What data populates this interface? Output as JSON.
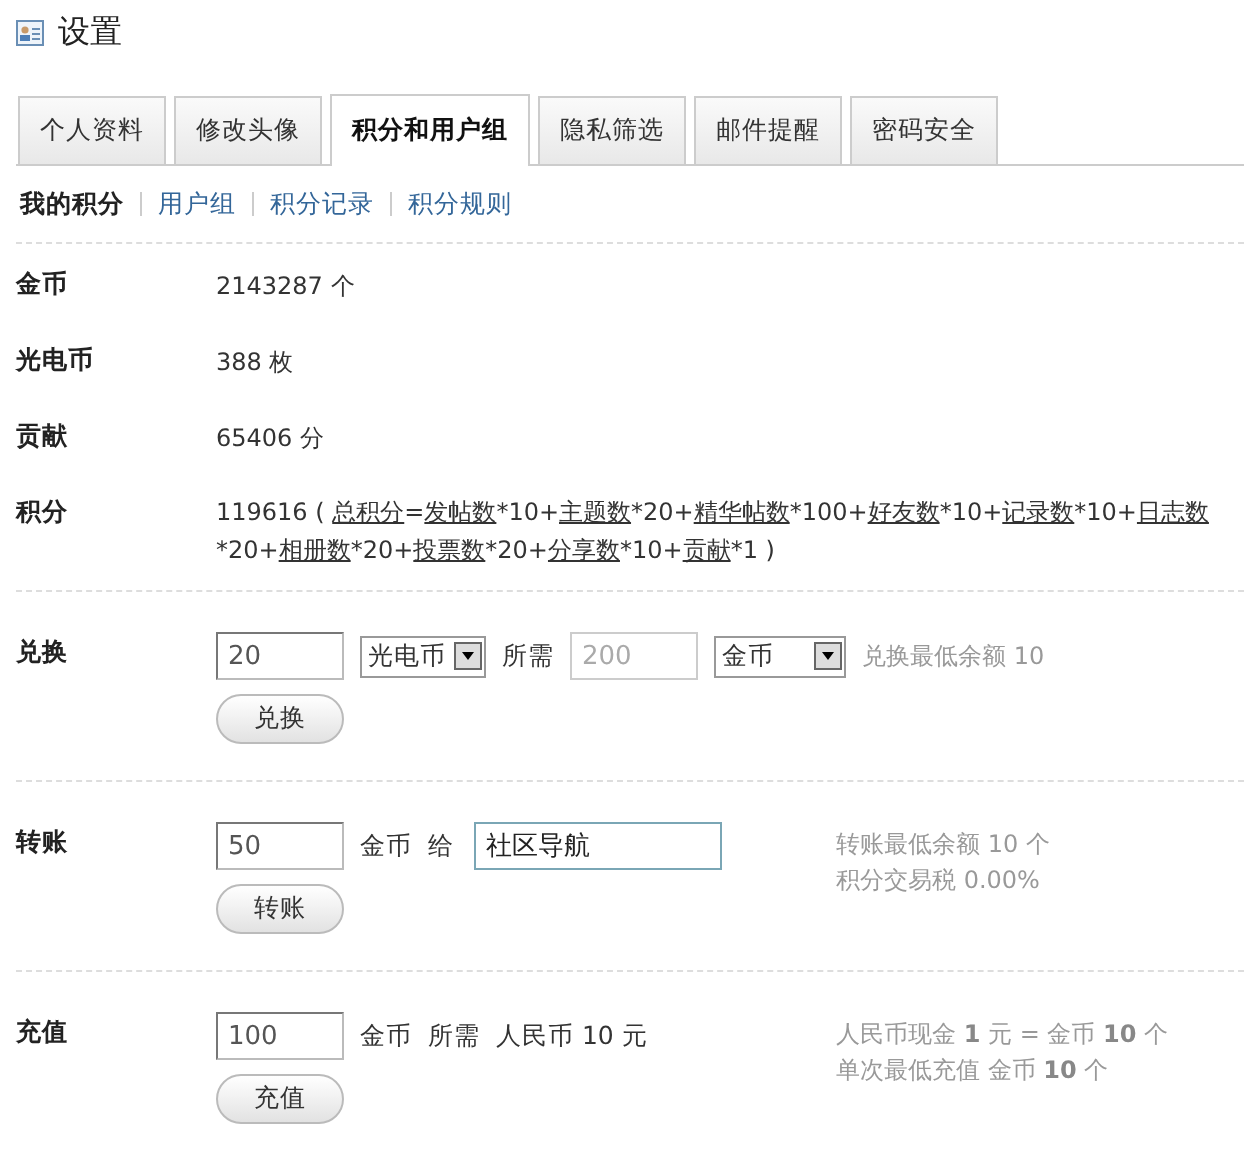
{
  "header": {
    "title": "设置"
  },
  "tabs": [
    {
      "label": "个人资料",
      "selected": false
    },
    {
      "label": "修改头像",
      "selected": false
    },
    {
      "label": "积分和用户组",
      "selected": true
    },
    {
      "label": "隐私筛选",
      "selected": false
    },
    {
      "label": "邮件提醒",
      "selected": false
    },
    {
      "label": "密码安全",
      "selected": false
    }
  ],
  "subnav": [
    {
      "label": "我的积分",
      "selected": true
    },
    {
      "label": "用户组",
      "selected": false
    },
    {
      "label": "积分记录",
      "selected": false
    },
    {
      "label": "积分规则",
      "selected": false
    }
  ],
  "stats": [
    {
      "label": "金币",
      "value": "2143287 个"
    },
    {
      "label": "光电币",
      "value": "388 枚"
    },
    {
      "label": "贡献",
      "value": "65406 分"
    }
  ],
  "credits": {
    "label": "积分",
    "value": "119616 (",
    "end": ")",
    "parts": [
      {
        "kind": "link",
        "text": "总积分"
      },
      {
        "kind": "text",
        "text": "="
      },
      {
        "kind": "link",
        "text": "发帖数"
      },
      {
        "kind": "text",
        "text": "*10+"
      },
      {
        "kind": "link",
        "text": "主题数"
      },
      {
        "kind": "text",
        "text": "*20+"
      },
      {
        "kind": "link",
        "text": "精华帖数"
      },
      {
        "kind": "text",
        "text": "*100+"
      },
      {
        "kind": "link",
        "text": "好友数"
      },
      {
        "kind": "text",
        "text": "*10+"
      },
      {
        "kind": "link",
        "text": "记录数"
      },
      {
        "kind": "text",
        "text": "*10+"
      },
      {
        "kind": "link",
        "text": "日志数"
      },
      {
        "kind": "text",
        "text": "*20+"
      },
      {
        "kind": "link",
        "text": "相册数"
      },
      {
        "kind": "text",
        "text": "*20+"
      },
      {
        "kind": "link",
        "text": "投票数"
      },
      {
        "kind": "text",
        "text": "*20+"
      },
      {
        "kind": "link",
        "text": "分享数"
      },
      {
        "kind": "text",
        "text": "*10+"
      },
      {
        "kind": "link",
        "text": "贡献"
      },
      {
        "kind": "text",
        "text": "*1"
      }
    ]
  },
  "exchange": {
    "label": "兑换",
    "amount": "20",
    "from": "光电币",
    "needed_label": "所需",
    "cost": "200",
    "cost_disabled": true,
    "to": "金币",
    "note": "兑换最低余额 10",
    "button": "兑换"
  },
  "transfer": {
    "label": "转账",
    "amount": "50",
    "unit": "金币",
    "to_label": "给",
    "recipient": "社区导航",
    "recipient_focused": true,
    "notes": [
      "转账最低余额 10 个",
      "积分交易税 0.00%"
    ],
    "button": "转账"
  },
  "recharge": {
    "label": "充值",
    "amount": "100",
    "texts": [
      "金币",
      "所需",
      "人民币 10 元"
    ],
    "notes": [
      "人民币现金 **1** 元 = 金币 **10** 个",
      "单次最低充值 金币 **10** 个"
    ],
    "button": "充值"
  }
}
